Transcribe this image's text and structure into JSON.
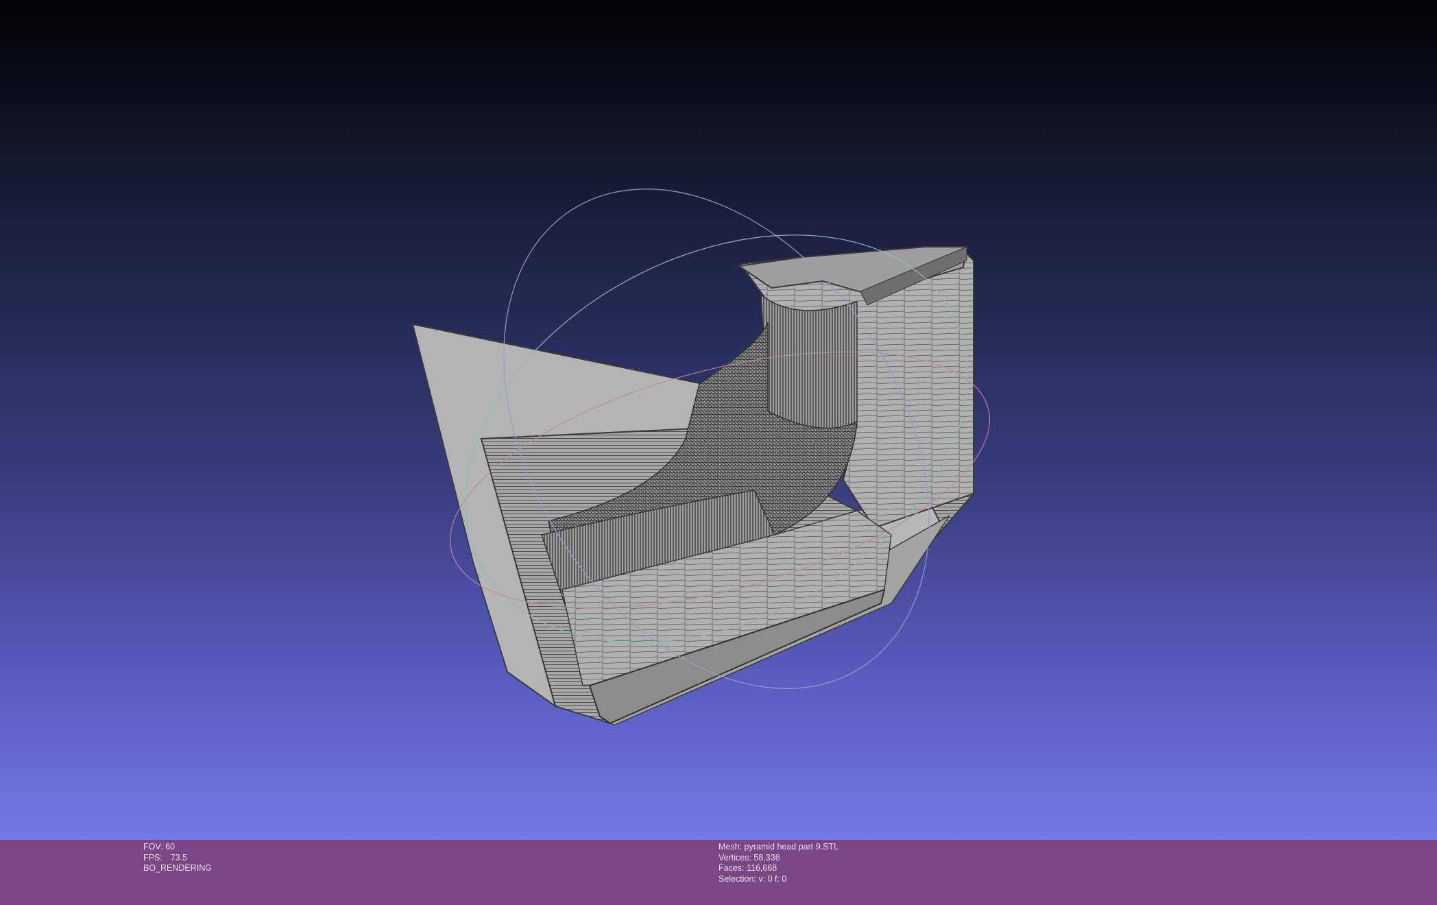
{
  "viewer": {
    "fov_label": "FOV: 60",
    "fps_label": "FPS:",
    "fps_value": "73.5",
    "render_mode": "BO_RENDERING"
  },
  "mesh_info": {
    "mesh_name": "Mesh: pyramid head part 9.STL",
    "vertices": "Vertices: 58,336",
    "faces": "Faces: 116,668",
    "selection": "Selection: v: 0 f: 0"
  },
  "colors": {
    "bottom_bar": "#7c4585",
    "background_top": "#020204",
    "background_bottom": "#7478e8",
    "mesh_fill": "#a9a9a9",
    "wireframe": "#3a3a3a"
  },
  "icons": {
    "trackball": "trackball-gizmo-icon"
  }
}
